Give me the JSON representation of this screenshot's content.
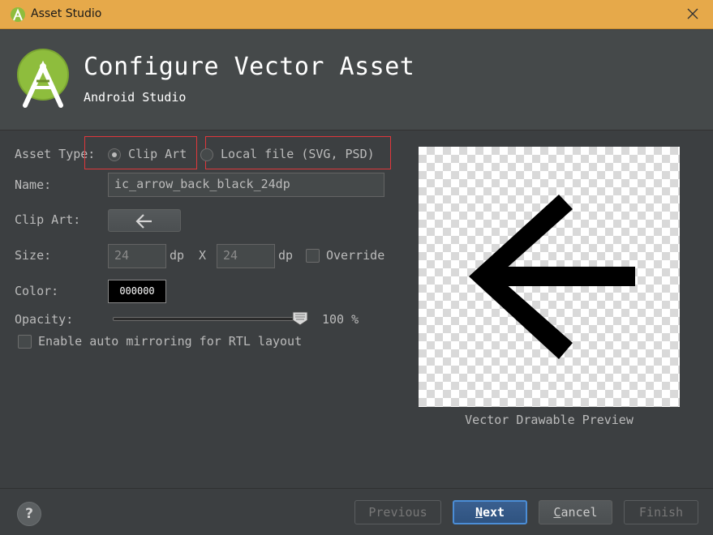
{
  "window": {
    "title": "Asset Studio",
    "icon": "android-studio-icon",
    "close_icon": "close-icon"
  },
  "header": {
    "title": "Configure Vector Asset",
    "subtitle": "Android Studio",
    "logo": "android-studio-logo"
  },
  "form": {
    "asset_type_label": "Asset Type:",
    "asset_type_options": [
      {
        "label": "Clip Art",
        "selected": true
      },
      {
        "label": "Local file (SVG, PSD)",
        "selected": false
      }
    ],
    "name_label": "Name:",
    "name_value": "ic_arrow_back_black_24dp",
    "clip_art_label": "Clip Art:",
    "clip_art_icon": "arrow-back-icon",
    "size_label": "Size:",
    "width_value": "24",
    "width_unit": "dp",
    "size_separator": "X",
    "height_value": "24",
    "height_unit": "dp",
    "override_label": "Override",
    "override_checked": false,
    "color_label": "Color:",
    "color_value": "000000",
    "opacity_label": "Opacity:",
    "opacity_value": 100,
    "opacity_text": "100 %",
    "mirroring_label": "Enable auto mirroring for RTL layout",
    "mirroring_checked": false
  },
  "preview": {
    "caption": "Vector Drawable Preview",
    "icon": "arrow-back-icon"
  },
  "footer": {
    "help_label": "?",
    "buttons": {
      "previous": {
        "label": "Previous",
        "enabled": false
      },
      "next": {
        "label": "Next",
        "mnemonic": "N",
        "rest": "ext",
        "enabled": true,
        "default": true
      },
      "cancel": {
        "label": "Cancel",
        "mnemonic": "C",
        "rest": "ancel",
        "enabled": true
      },
      "finish": {
        "label": "Finish",
        "enabled": false
      }
    }
  },
  "colors": {
    "titlebar": "#e6a94a",
    "dialog_bg": "#3c3f41",
    "header_bg": "#45494a",
    "highlight": "#e0373b",
    "default_button": "#4b8dd6",
    "android_green": "#8ebd3d"
  }
}
